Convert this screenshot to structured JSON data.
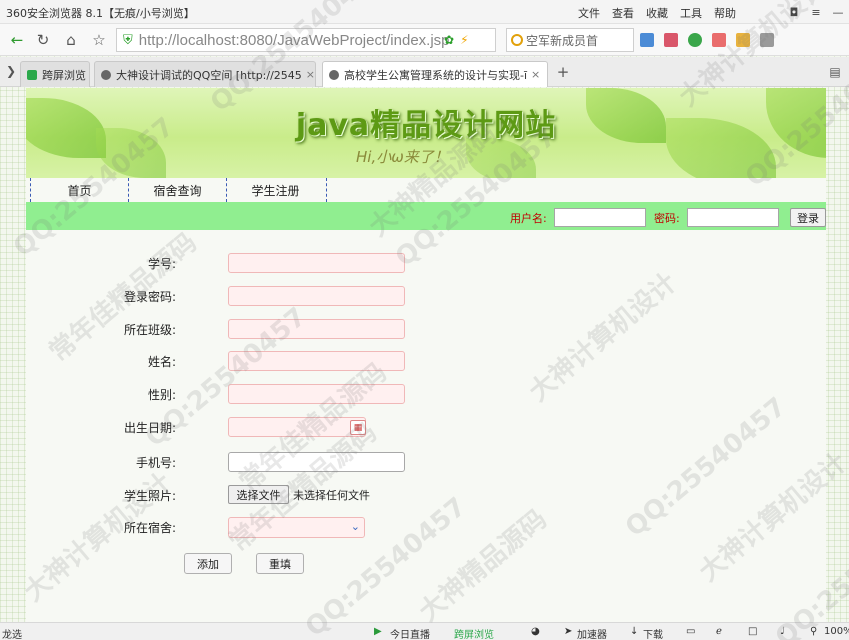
{
  "browser": {
    "title": "360安全浏览器 8.1【无痕/小号浏览】",
    "menu": [
      "文件",
      "查看",
      "收藏",
      "工具",
      "帮助"
    ],
    "url": "http://localhost:8080/JavaWebProject/index.jsp",
    "search_placeholder": "空军新成员首",
    "tabs": [
      {
        "label": "跨屏浏览",
        "close": ""
      },
      {
        "label": "大神设计调试的QQ空间 [http://2545",
        "close": "×"
      },
      {
        "label": "高校学生公寓管理系统的设计与实现-ī",
        "close": "×"
      }
    ],
    "new_tab": "+",
    "status": {
      "left": "龙选",
      "live": "今日直播",
      "cross": "跨屏浏览",
      "speed": "加速器",
      "download": "下载",
      "zoom": "100%"
    }
  },
  "site": {
    "title": "java精品设计网站",
    "subtitle": "Hi,小ω来了！",
    "menu": [
      "首页",
      "宿舍查询",
      "学生注册"
    ],
    "login": {
      "username_label": "用户名:",
      "password_label": "密码:",
      "button": "登录"
    }
  },
  "form": {
    "labels": [
      "学号:",
      "登录密码:",
      "所在班级:",
      "姓名:",
      "性别:",
      "出生日期:",
      "手机号:",
      "学生照片:",
      "所在宿舍:"
    ],
    "file_button": "选择文件",
    "file_status": "未选择任何文件",
    "add_button": "添加",
    "reset_button": "重填"
  },
  "watermarks": [
    "QQ:25454045",
    "QQ:25540457",
    "常年佳精品源码",
    "大神计算机设计",
    "大神计算机设计",
    "QQ:25540457",
    "大神精品源码",
    "常年佳精品源码",
    "QQ:25540457",
    "大神计算机设计",
    "QQ:25540457",
    "常年佳精品源码",
    "大神精品源码",
    "QQ:25540457",
    "大神计算机设计",
    "QQ:25540457",
    "QQ:25540457"
  ],
  "colors": {
    "login_bar": "#90ee90",
    "label_red": "#c00000",
    "required_field": "#fff0f0",
    "menu_divider": "#3b5bb5"
  }
}
